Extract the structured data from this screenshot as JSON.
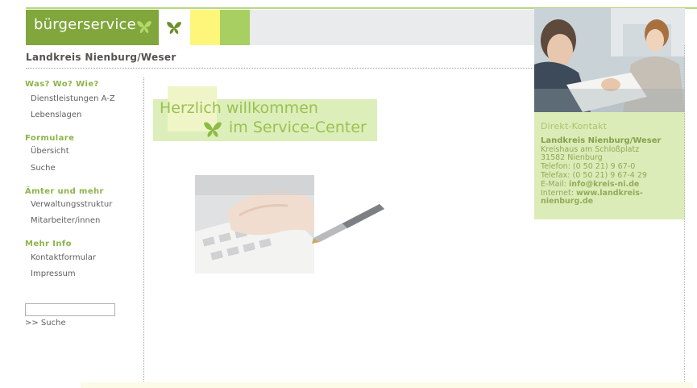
{
  "header": {
    "brand": "bürgerservice",
    "district_title": "Landkreis Nienburg/Weser"
  },
  "welcome": {
    "line1": "Herzlich willkommen",
    "line2": "im Service-Center"
  },
  "nav": {
    "sections": [
      {
        "heading": "Was? Wo? Wie?",
        "items": [
          "Dienstleistungen A-Z",
          "Lebenslagen"
        ]
      },
      {
        "heading": "Formulare",
        "items": [
          "Übersicht",
          "Suche"
        ]
      },
      {
        "heading": "Ämter und mehr",
        "items": [
          "Verwaltungsstruktur",
          "Mitarbeiter/innen"
        ]
      },
      {
        "heading": "Mehr Info",
        "items": [
          "Kontaktformular",
          "Impressum"
        ]
      }
    ]
  },
  "search": {
    "value": "",
    "link_label": ">> Suche"
  },
  "contact": {
    "heading": "Direkt-Kontakt",
    "org": "Landkreis Nienburg/Weser",
    "building": "Kreishaus am Schloßplatz",
    "city": "31582 Nienburg",
    "phone": "Telefon: (0 50 21) 9 67-0",
    "fax": "Telefax: (0 50 21) 9 67-4 29",
    "email_label": "E-Mail:",
    "email": "info@kreis-ni.de",
    "internet_label": "Internet:",
    "internet_part1": "www.landkreis-",
    "internet_part2": "nienburg.de"
  },
  "colors": {
    "brand_green": "#80a63c",
    "light_green": "#dceeba",
    "accent_yellow": "#fef67a"
  }
}
